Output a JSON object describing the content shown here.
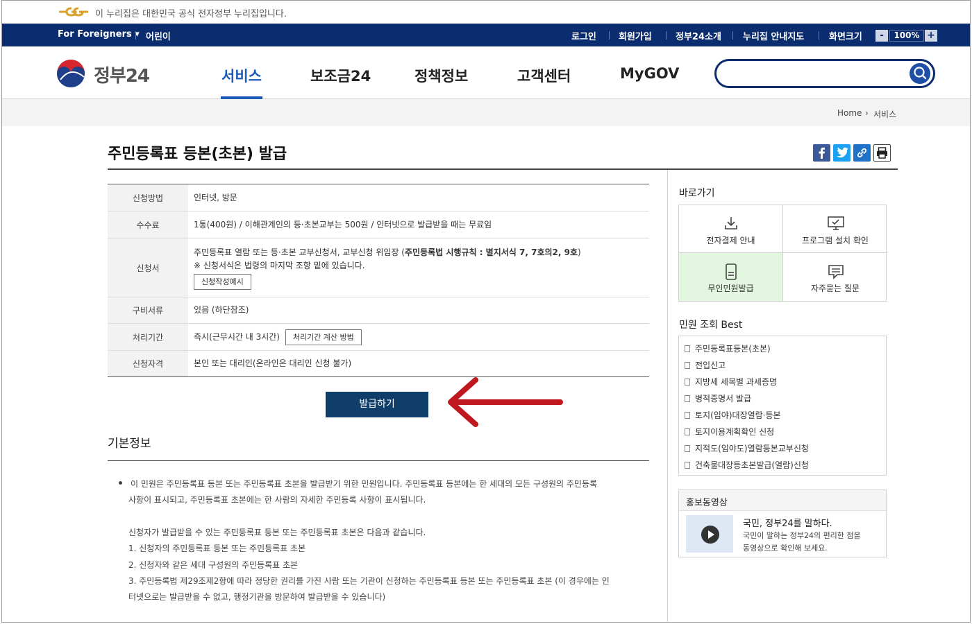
{
  "govbar": {
    "text": "이 누리집은 대한민국 공식 전자정부 누리집입니다."
  },
  "topnav": {
    "left": [
      "For Foreigners ▾",
      "어린이"
    ],
    "right": [
      "로그인",
      "회원가입",
      "정부24소개",
      "누리집 안내지도",
      "화면크기"
    ],
    "zoom": {
      "minus": "-",
      "value": "100%",
      "plus": "+"
    }
  },
  "header": {
    "logo_text": "정부24",
    "menu": [
      "서비스",
      "보조금24",
      "정책정보",
      "고객센터",
      "MyGOV"
    ],
    "active_menu": "서비스",
    "search_placeholder": ""
  },
  "breadcrumb": [
    "Home",
    "›",
    "서비스"
  ],
  "page": {
    "title": "주민등록표 등본(초본) 발급",
    "info": {
      "method_label": "신청방법",
      "method_value": "인터넷, 방문",
      "fee_label": "수수료",
      "fee_value": "1통(400원) / 이해관계인의 등·초본교부는 500원 / 인터넷으로 발급받을 때는 무료임",
      "form_label": "신청서",
      "form_line1_a": "주민등록표 열람 또는 등·초본 교부신청서, 교부신청 위임장 (",
      "form_line1_b": "주민등록법 시행규칙 : 별지서식 7, 7호의2, 9호",
      "form_line1_c": ")",
      "form_line2": "※ 신청서식은 법령의 마지막 조항 밑에 있습니다.",
      "form_btn": "신청작성예시",
      "docs_label": "구비서류",
      "docs_value": "있음 (하단참조)",
      "period_label": "처리기간",
      "period_value": "즉시(근무시간 내 3시간)",
      "period_btn": "처리기간 계산 방법",
      "qual_label": "신청자격",
      "qual_value": "본인 또는 대리인(온라인은 대리인 신청 불가)"
    },
    "issue_btn": "발급하기",
    "basic_title": "기본정보",
    "desc": [
      "이 민원은 주민등록표 등본 또는 주민등록표 초본을 발급받기 위한 민원입니다. 주민등록표 등본에는 한 세대의 모든 구성원의 주민등록",
      "사항이 표시되고, 주민등록표 초본에는 한 사람의 자세한 주민등록 사항이 표시됩니다.",
      "신청자가 발급받을 수 있는 주민등록표 등본 또는 주민등록표 초본은 다음과 같습니다.",
      "1. 신청자의 주민등록표 등본 또는 주민등록표 초본",
      "2. 신청자와 같은 세대 구성원의 주민등록표 초본",
      "3. 주민등록법 제29조제2항에 따라 정당한 권리를 가진 사람 또는 기관이 신청하는 주민등록표 등본 또는 주민등록표 초본 (이 경우에는 인",
      "터넷으로는 발급받을 수 없고, 행정기관을 방문하여 발급받을 수 있습니다)"
    ]
  },
  "side": {
    "quick_title": "바로가기",
    "quick": [
      "전자결제 안내",
      "프로그램 설치 확인",
      "무인민원발급",
      "자주묻는 질문"
    ],
    "best_title": "민원 조회 Best",
    "best": [
      "주민등록표등본(초본)",
      "전입신고",
      "지방세 세목별 과세증명",
      "병적증명서 발급",
      "토지(임야)대장열람·등본",
      "토지이용계획확인 신청",
      "지적도(임야도)열람등본교부신청",
      "건축물대장등초본발급(열람)신청"
    ],
    "video_title": "홍보동영상",
    "video_heading": "국민, 정부24를 말하다.",
    "video_desc1": "국민이 말하는 정부24의 편리한 점을",
    "video_desc2": "동영상으로 확인해 보세요."
  },
  "colors": {
    "navy": "#0b2c6e",
    "accent_blue": "#1b5ab8",
    "issue_btn": "#103e6b",
    "highlight_cell": "#e3f6df",
    "arrow_red": "#c0181f"
  }
}
